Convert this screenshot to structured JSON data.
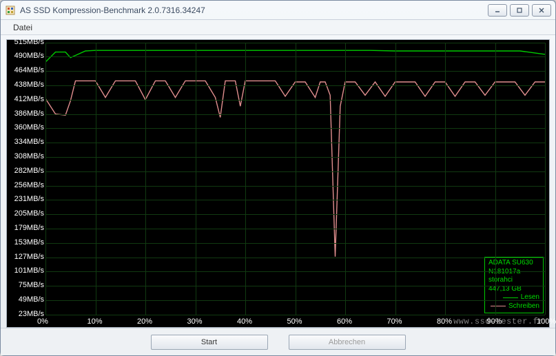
{
  "window": {
    "title": "AS SSD Kompression-Benchmark 2.0.7316.34247"
  },
  "menu": {
    "file": "Datei"
  },
  "device": {
    "model": "ADATA SU630",
    "serial": "N181017a",
    "driver": "storahci",
    "capacity": "447,13 GB"
  },
  "legend": {
    "read": "Lesen",
    "write": "Schreiben",
    "read_color": "#00cc00",
    "write_color": "#e28f8f"
  },
  "buttons": {
    "start": "Start",
    "abort": "Abbrechen"
  },
  "watermark": "www.ssd-tester.fr",
  "chart_data": {
    "type": "line",
    "xlabel": "",
    "ylabel": "",
    "x_unit": "%",
    "y_unit": "MB/s",
    "x_ticks": [
      0,
      10,
      20,
      30,
      40,
      50,
      60,
      70,
      80,
      90,
      100
    ],
    "y_ticks": [
      23,
      49,
      75,
      101,
      127,
      153,
      179,
      205,
      231,
      256,
      282,
      308,
      334,
      360,
      386,
      412,
      438,
      464,
      490,
      515
    ],
    "xlim": [
      0,
      100
    ],
    "ylim": [
      23,
      515
    ],
    "series": [
      {
        "name": "Lesen",
        "color": "#00cc00",
        "x": [
          0,
          2,
          4,
          5,
          6,
          8,
          10,
          15,
          20,
          25,
          30,
          35,
          40,
          45,
          50,
          55,
          60,
          65,
          70,
          75,
          80,
          85,
          90,
          95,
          100
        ],
        "values": [
          480,
          498,
          498,
          488,
          492,
          500,
          501,
          501,
          501,
          501,
          501,
          501,
          501,
          501,
          501,
          501,
          501,
          501,
          500,
          500,
          500,
          500,
          500,
          500,
          494
        ]
      },
      {
        "name": "Schreiben",
        "color": "#e28f8f",
        "x": [
          0,
          2,
          4,
          5,
          6,
          8,
          10,
          12,
          14,
          16,
          18,
          20,
          22,
          24,
          26,
          28,
          30,
          32,
          34,
          35,
          36,
          38,
          39,
          40,
          42,
          44,
          46,
          48,
          50,
          52,
          54,
          55,
          56,
          57,
          58,
          59,
          60,
          62,
          64,
          66,
          68,
          70,
          72,
          74,
          76,
          78,
          80,
          82,
          84,
          86,
          88,
          90,
          92,
          94,
          96,
          98,
          100
        ],
        "values": [
          414,
          386,
          384,
          410,
          446,
          446,
          446,
          416,
          446,
          446,
          446,
          412,
          446,
          446,
          416,
          446,
          446,
          446,
          416,
          380,
          446,
          446,
          400,
          446,
          446,
          446,
          446,
          418,
          444,
          444,
          416,
          444,
          444,
          420,
          128,
          400,
          444,
          444,
          420,
          444,
          418,
          444,
          444,
          444,
          418,
          444,
          444,
          418,
          444,
          444,
          420,
          444,
          444,
          444,
          420,
          444,
          444
        ]
      }
    ]
  }
}
